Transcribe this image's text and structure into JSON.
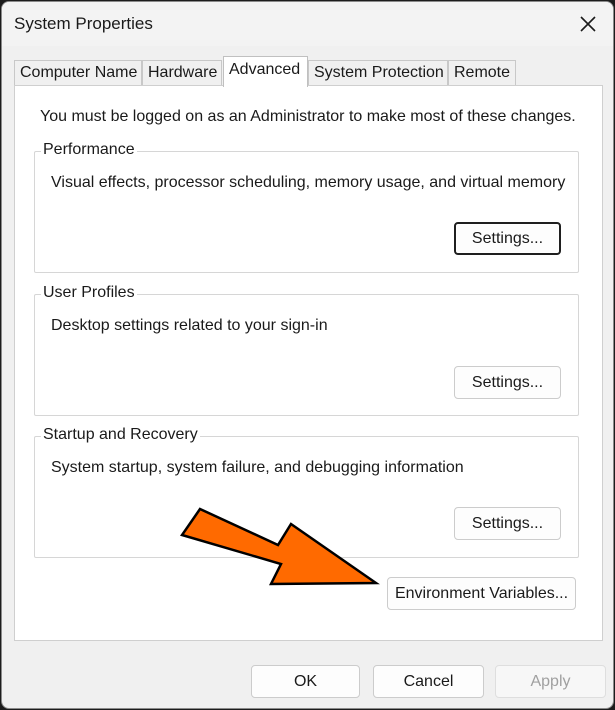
{
  "window": {
    "title": "System Properties"
  },
  "tabs": [
    {
      "label": "Computer Name",
      "active": false
    },
    {
      "label": "Hardware",
      "active": false
    },
    {
      "label": "Advanced",
      "active": true
    },
    {
      "label": "System Protection",
      "active": false
    },
    {
      "label": "Remote",
      "active": false
    }
  ],
  "advanced": {
    "note": "You must be logged on as an Administrator to make most of these changes.",
    "performance": {
      "title": "Performance",
      "description": "Visual effects, processor scheduling, memory usage, and virtual memory",
      "button": "Settings..."
    },
    "user_profiles": {
      "title": "User Profiles",
      "description": "Desktop settings related to your sign-in",
      "button": "Settings..."
    },
    "startup_recovery": {
      "title": "Startup and Recovery",
      "description": "System startup, system failure, and debugging information",
      "button": "Settings..."
    },
    "env_button": "Environment Variables..."
  },
  "footer": {
    "ok": "OK",
    "cancel": "Cancel",
    "apply": "Apply"
  },
  "icons": {
    "close": "close-icon",
    "annotation": "arrow-annotation-icon"
  },
  "colors": {
    "arrow_fill": "#ff6a00",
    "arrow_stroke": "#000000"
  }
}
